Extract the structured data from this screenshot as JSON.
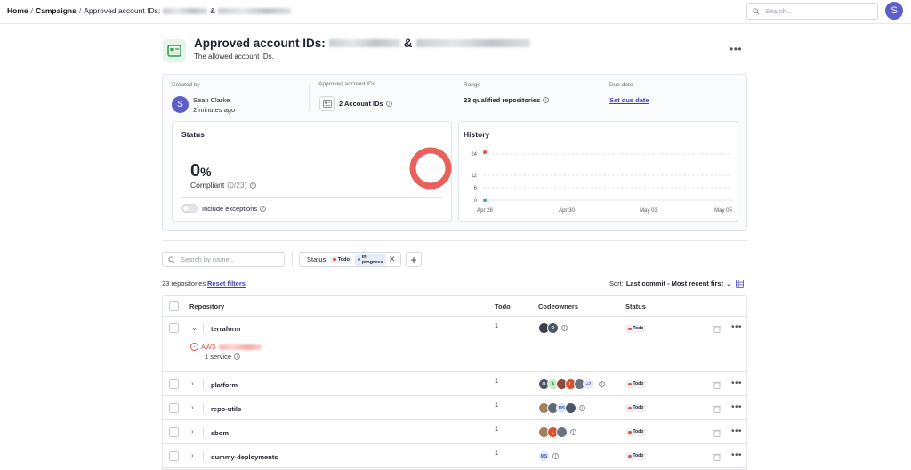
{
  "breadcrumb": {
    "home": "Home",
    "campaigns": "Campaigns",
    "current": "Approved account IDs:",
    "ampersand": "&"
  },
  "search_top": {
    "placeholder": "Search..."
  },
  "user": {
    "initial": "S"
  },
  "header": {
    "title": "Approved account IDs:",
    "ampersand": "&",
    "subtitle": "The allowed account IDs."
  },
  "meta": {
    "created_by_label": "Created by",
    "creator_initial": "S",
    "creator_name": "Sean Clarke",
    "created_time": "2 minutes ago",
    "approved_label": "Approved account IDs",
    "account_count": "2 Account IDs",
    "range_label": "Range",
    "range_value": "23 qualified repositories",
    "due_label": "Due date",
    "due_link": "Set due date"
  },
  "status_card": {
    "title": "Status",
    "percent": "0",
    "percent_sign": "%",
    "compliant_label": "Compliant",
    "compliant_fraction": "(0/23)",
    "compliance_ratio": 0,
    "include_exceptions_label": "Include exceptions",
    "include_exceptions_on": false
  },
  "history_card": {
    "title": "History",
    "y_ticks": [
      "24",
      "12",
      "6",
      "0"
    ],
    "x_ticks": [
      "Apr 28",
      "Apr 30",
      "May 03",
      "May 05"
    ]
  },
  "filters": {
    "search_placeholder": "Search by name...",
    "status_label": "Status:",
    "status_pills": [
      {
        "label": "Todo",
        "color": "#e0524c"
      },
      {
        "label": "In progress",
        "color": "#3b82f6"
      }
    ]
  },
  "list": {
    "count": "23 repositories",
    "reset": "Reset filters",
    "sort_label": "Sort:",
    "sort_value": "Last commit - Most recent first"
  },
  "table": {
    "headers": {
      "repo": "Repository",
      "todo": "Todo",
      "owners": "Codeowners",
      "status": "Status"
    },
    "rows": [
      {
        "name": "terraform",
        "todo": "1",
        "status": "Todo",
        "aws": "AWS",
        "services": "1 service",
        "extra": ""
      },
      {
        "name": "platform",
        "todo": "1",
        "status": "Todo",
        "extra": "+2"
      },
      {
        "name": "repo-utils",
        "todo": "1",
        "status": "Todo",
        "extra": ""
      },
      {
        "name": "sbom",
        "todo": "1",
        "status": "Todo",
        "extra": ""
      },
      {
        "name": "dummy-deployments",
        "todo": "1",
        "status": "Todo",
        "extra": ""
      }
    ]
  },
  "colors": {
    "accent": "#5b5fc7",
    "todo": "#e0524c",
    "donut": "#e8615a",
    "link": "#3b3fc4"
  }
}
